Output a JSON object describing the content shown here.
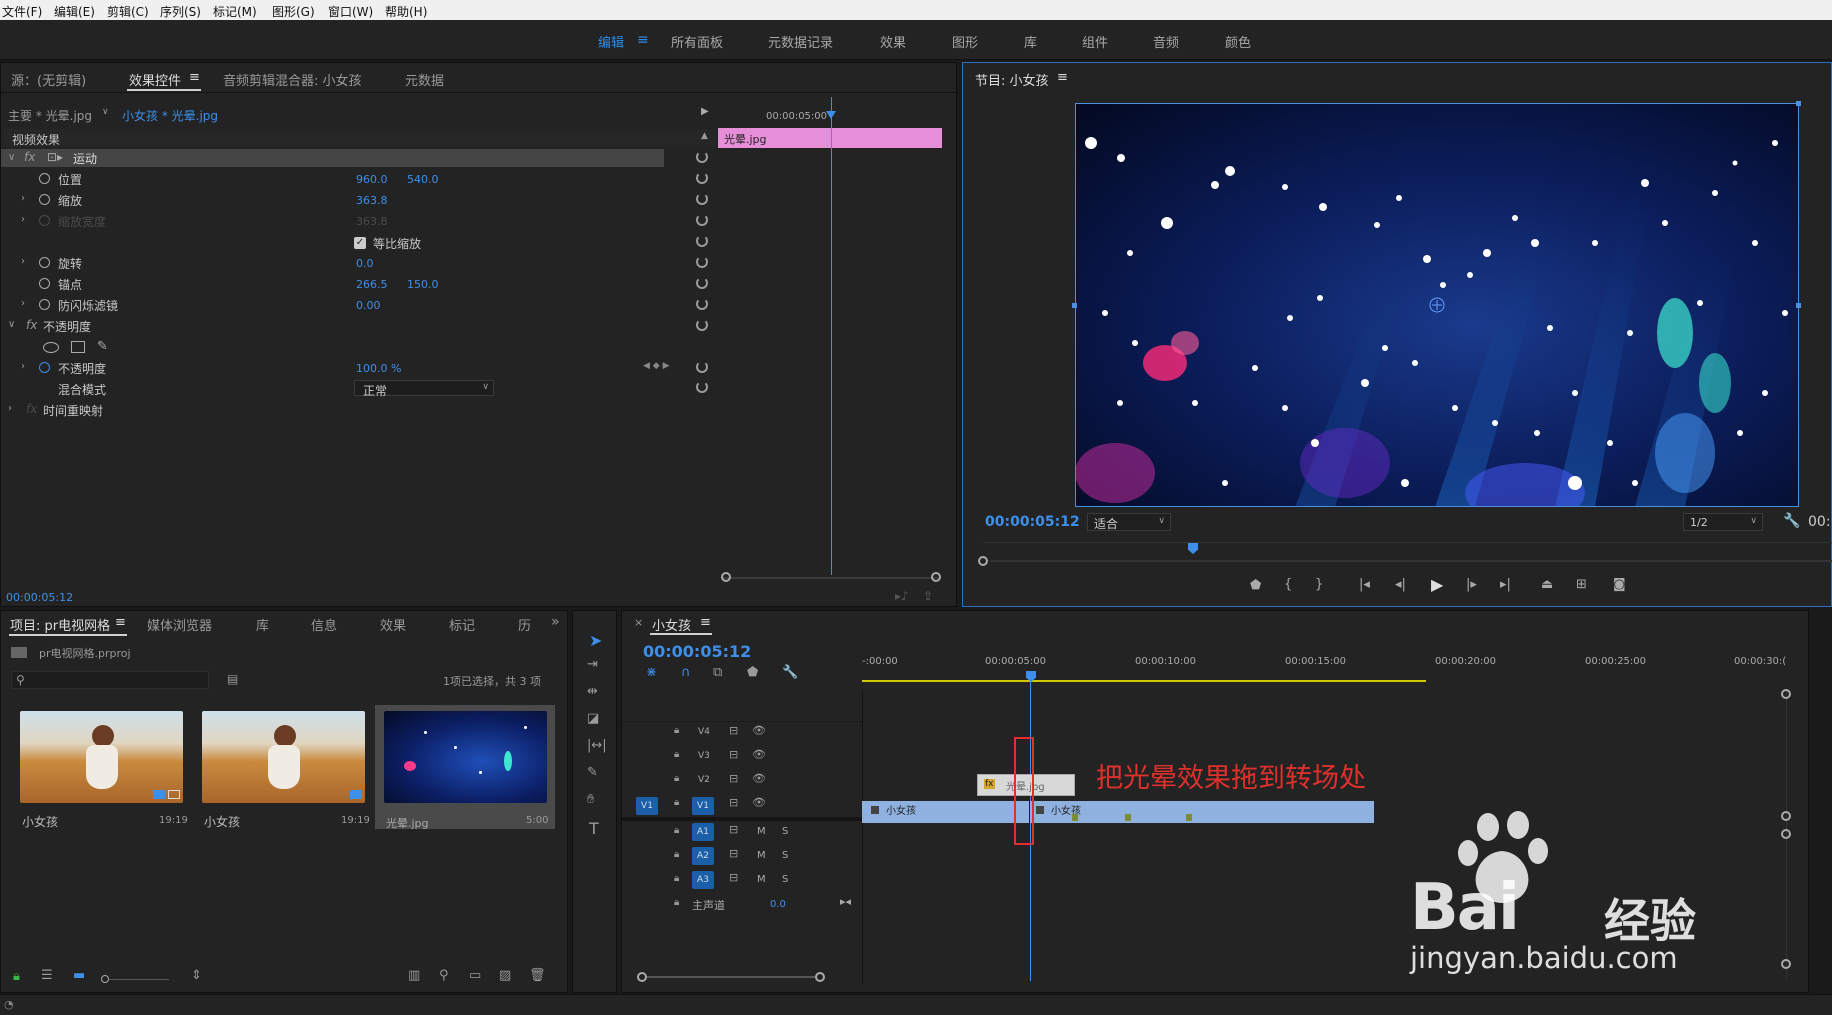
{
  "menu": [
    "文件(F)",
    "编辑(E)",
    "剪辑(C)",
    "序列(S)",
    "标记(M)",
    "图形(G)",
    "窗口(W)",
    "帮助(H)"
  ],
  "workspaces": [
    "编辑",
    "所有面板",
    "元数据记录",
    "效果",
    "图形",
    "库",
    "组件",
    "音频",
    "颜色"
  ],
  "source_panel": {
    "tabs": [
      "源：(无剪辑)",
      "效果控件",
      "音频剪辑混合器: 小女孩",
      "元数据"
    ],
    "master_label": "主要 * 光晕.jpg",
    "clip_label": "小女孩 * 光晕.jpg",
    "mini_timecode": "00:00:05:00",
    "clip_bar_label": "光晕.jpg",
    "section_video": "视频效果",
    "footer_timecode": "00:00:05:12",
    "rows": {
      "motion": "运动",
      "position_label": "位置",
      "position_x": "960.0",
      "position_y": "540.0",
      "scale_label": "缩放",
      "scale_value": "363.8",
      "scale_width_label": "缩放宽度",
      "scale_width_value": "363.8",
      "uniform_label": "等比缩放",
      "rotation_label": "旋转",
      "rotation_value": "0.0",
      "anchor_label": "锚点",
      "anchor_x": "266.5",
      "anchor_y": "150.0",
      "flicker_label": "防闪烁滤镜",
      "flicker_value": "0.00",
      "opacity_section": "不透明度",
      "opacity_label": "不透明度",
      "opacity_value": "100.0 %",
      "blend_label": "混合模式",
      "blend_value": "正常",
      "time_remap": "时间重映射"
    }
  },
  "program_monitor": {
    "title": "节目: 小女孩",
    "timecode": "00:00:05:12",
    "fit": "适合",
    "resolution": "1/2",
    "right_tc": "00:"
  },
  "project_panel": {
    "tabs": [
      "项目: pr电视网格",
      "媒体浏览器",
      "库",
      "信息",
      "效果",
      "标记",
      "历"
    ],
    "file": "pr电视网格.prproj",
    "count": "1项已选择，共 3 项",
    "items": [
      {
        "name": "小女孩",
        "duration": "19:19"
      },
      {
        "name": "小女孩",
        "duration": "19:19"
      },
      {
        "name": "光晕.jpg",
        "duration": "5:00"
      }
    ]
  },
  "timeline": {
    "title": "小女孩",
    "timecode": "00:00:05:12",
    "ruler": [
      "-:00:00",
      "00:00:05:00",
      "00:00:10:00",
      "00:00:15:00",
      "00:00:20:00",
      "00:00:25:00",
      "00:00:30:("
    ],
    "tracks_video": [
      "V4",
      "V3",
      "V2",
      "V1"
    ],
    "tracks_audio": [
      "A1",
      "A2",
      "A3"
    ],
    "master_label": "主声道",
    "master_value": "0.0",
    "clip_v1a": "小女孩",
    "clip_v1b": "小女孩",
    "clip_v2": "光晕.jpg",
    "m_label": "M",
    "s_label": "S"
  },
  "annotation": "把光晕效果拖到转场处",
  "watermark": {
    "brand": "Bai",
    "brand2": "经验",
    "url": "jingyan.baidu.com"
  },
  "colors": {
    "accent": "#2d8ceb",
    "clip_pink": "#e68fd8",
    "clip_blue": "#8fb1df",
    "annotation_red": "#e0302b"
  }
}
